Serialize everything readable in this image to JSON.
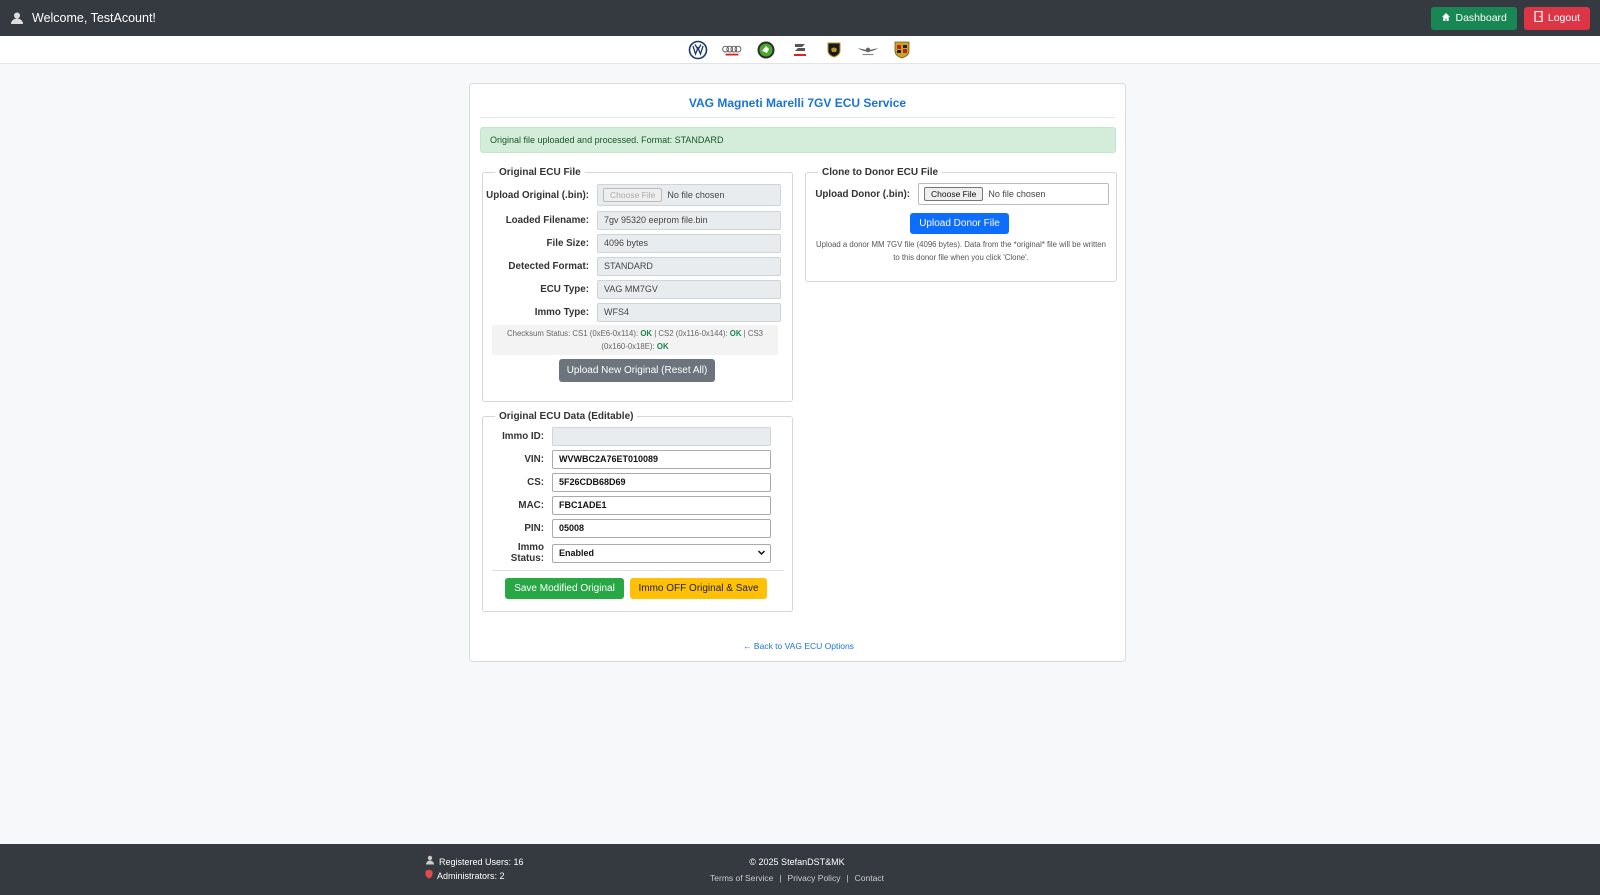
{
  "header": {
    "welcome": "Welcome, TestAcount!",
    "dashboard_label": "Dashboard",
    "logout_label": "Logout"
  },
  "brands": [
    "volkswagen-logo",
    "audi-logo",
    "skoda-logo",
    "seat-logo",
    "lamborghini-logo",
    "bentley-logo",
    "porsche-logo"
  ],
  "card": {
    "title": "VAG Magneti Marelli 7GV ECU Service",
    "alert": "Original file uploaded and processed. Format: STANDARD",
    "original": {
      "legend": "Original ECU File",
      "upload_label": "Upload Original (.bin):",
      "choose_file": "Choose File",
      "no_file": "No file chosen",
      "loaded_filename_label": "Loaded Filename:",
      "loaded_filename": "7gv 95320 eeprom file.bin",
      "file_size_label": "File Size:",
      "file_size": "4096 bytes",
      "detected_format_label": "Detected Format:",
      "detected_format": "STANDARD",
      "ecu_type_label": "ECU Type:",
      "ecu_type": "VAG MM7GV",
      "immo_type_label": "Immo Type:",
      "immo_type": "WFS4",
      "checksum_prefix": "Checksum Status: CS1 (0xE6-0x114):",
      "cs1": "OK",
      "cs2_text": "| CS2 (0x116-0x144):",
      "cs2": "OK",
      "cs3_text": "| CS3 (0x160-0x18E):",
      "cs3": "OK",
      "reset_button": "Upload New Original (Reset All)"
    },
    "donor": {
      "legend": "Clone to Donor ECU File",
      "upload_label": "Upload Donor (.bin):",
      "choose_file": "Choose File",
      "no_file": "No file chosen",
      "upload_button": "Upload Donor File",
      "help": "Upload a donor MM 7GV file (4096 bytes). Data from the *original* file will be written to this donor file when you click 'Clone'."
    },
    "data": {
      "legend": "Original ECU Data (Editable)",
      "immo_id_label": "Immo ID:",
      "immo_id": "",
      "vin_label": "VIN:",
      "vin": "WVWBC2A76ET010089",
      "cs_label": "CS:",
      "cs": "5F26CDB68D69",
      "mac_label": "MAC:",
      "mac": "FBC1ADE1",
      "pin_label": "PIN:",
      "pin": "05008",
      "immo_status_label": "Immo Status:",
      "immo_status": "Enabled",
      "save_button": "Save Modified Original",
      "immo_off_button": "Immo OFF Original & Save"
    },
    "back_link": "← Back to VAG ECU Options"
  },
  "footer": {
    "registered_users": "Registered Users: 16",
    "administrators": "Administrators: 2",
    "copyright": "© 2025 StefanDST&MK",
    "terms": "Terms of Service",
    "privacy": "Privacy Policy",
    "contact": "Contact"
  },
  "colors": {
    "topbar": "#343a40",
    "accent_blue": "#1a73d9",
    "success": "#198754",
    "danger": "#dc3545",
    "warning": "#ffc107"
  }
}
